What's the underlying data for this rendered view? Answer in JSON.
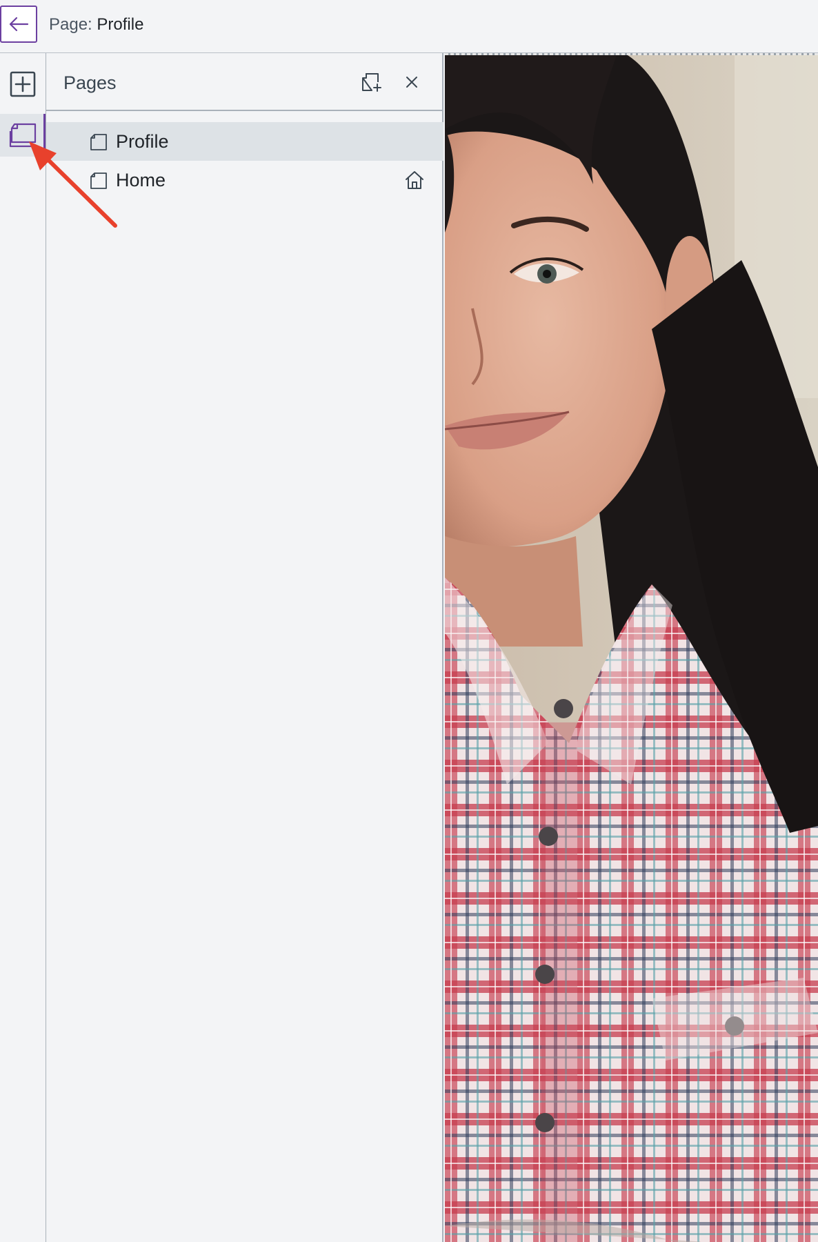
{
  "header": {
    "page_prefix": "Page: ",
    "page_name": "Profile"
  },
  "panel": {
    "title": "Pages",
    "pages": [
      {
        "label": "Profile",
        "selected": true,
        "is_home": false
      },
      {
        "label": "Home",
        "selected": false,
        "is_home": true
      }
    ]
  },
  "colors": {
    "accent": "#6b3fa0",
    "panel_bg": "#f3f4f6",
    "selected_row": "#dde2e6",
    "annotation": "#e8412c"
  },
  "icons": {
    "back": "arrow-left-icon",
    "add_element": "plus-square-icon",
    "pages": "pages-icon",
    "add_page": "add-page-icon",
    "close": "close-icon",
    "page": "page-icon",
    "home": "home-icon"
  }
}
